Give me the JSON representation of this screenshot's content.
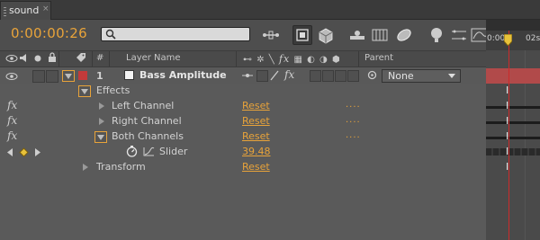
{
  "tab": {
    "label": "sound",
    "close": "×"
  },
  "timecode": "0:00:00:26",
  "search": {
    "placeholder": ""
  },
  "header": {
    "num_label": "#",
    "layer_name_label": "Layer Name",
    "parent_label": "Parent"
  },
  "layer": {
    "number": "1",
    "name": "Bass Amplitude",
    "parent_value": "None",
    "label_color": "#c23a3a"
  },
  "rows": {
    "effects": "Effects",
    "left_channel": "Left Channel",
    "right_channel": "Right Channel",
    "both_channels": "Both Channels",
    "slider": "Slider",
    "slider_value": "39.48",
    "transform": "Transform",
    "reset": "Reset",
    "dots": "....",
    "fx": "fx"
  },
  "timeline": {
    "start_label": "0:00s",
    "next_label": "02s"
  },
  "colors": {
    "accent": "#e8a33a",
    "playhead": "#cc2a2a",
    "layer_bar": "#b14a4a"
  }
}
